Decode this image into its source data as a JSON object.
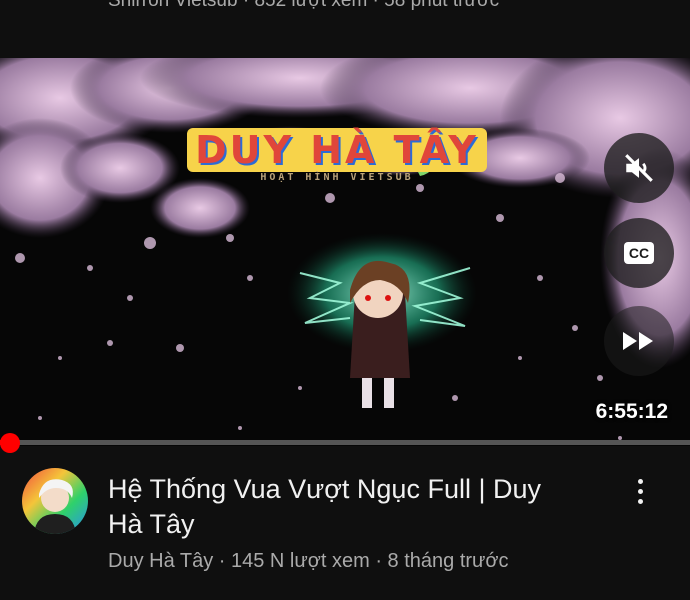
{
  "previous_video": {
    "meta": "Shirron Vietsub · 852 lượt xem · 58 phút trước"
  },
  "player": {
    "logo_text": "DUY HÀ TÂY",
    "logo_subtext": "HOẠT HÌNH VIETSUB",
    "duration": "6:55:12",
    "muted": true,
    "captions_label": "CC",
    "progress": 0.015
  },
  "video": {
    "title": "Hệ Thống Vua Vượt Ngục Full | Duy Hà Tây",
    "meta": "Duy Hà Tây · 145 N lượt xem · 8 tháng trước"
  },
  "colors": {
    "background": "#0f0f0f",
    "progress": "#ff0000",
    "secondary_text": "#aaaaaa"
  },
  "icons": [
    "volume-off-icon",
    "closed-captions-icon",
    "fast-forward-icon",
    "more-vert-icon",
    "channel-avatar"
  ]
}
